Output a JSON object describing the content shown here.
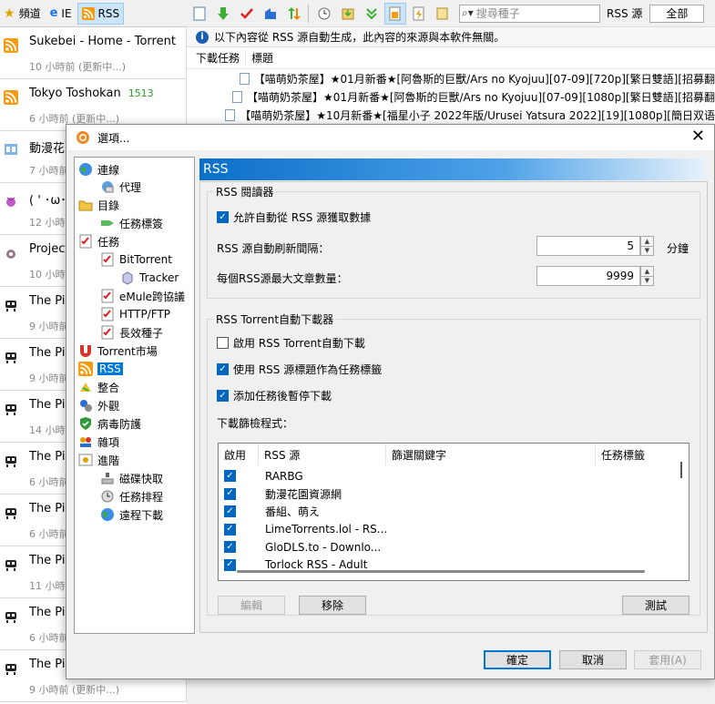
{
  "app_tabs": [
    {
      "label": "頻道",
      "icon": "star-icon"
    },
    {
      "label": "IE",
      "icon": "ie-icon"
    },
    {
      "label": "RSS",
      "icon": "rss-icon",
      "active": true
    }
  ],
  "feeds": [
    {
      "name": "Sukebei - Home - Torrent",
      "count": "",
      "time": "10 小時前 (更新中...)",
      "icon": "rss-icon"
    },
    {
      "name": "Tokyo Toshokan",
      "count": "1513",
      "time": "6 小時前 (更新中...)",
      "icon": "rss-icon"
    },
    {
      "name": "動漫花",
      "count": "",
      "time": "7 小時前",
      "icon": "anime-icon"
    },
    {
      "name": "( ' ･ω･",
      "count": "",
      "time": "12 小時前",
      "icon": "purple-icon"
    },
    {
      "name": "Project",
      "count": "",
      "time": "10 小時前",
      "icon": "project-icon"
    },
    {
      "name": "The Pir",
      "count": "",
      "time": "9 小時前",
      "icon": "pirate-icon"
    },
    {
      "name": "The Pir",
      "count": "",
      "time": "9 小時前",
      "icon": "pirate-icon"
    },
    {
      "name": "The Pir",
      "count": "",
      "time": "14 小時前",
      "icon": "pirate-icon"
    },
    {
      "name": "The Pir",
      "count": "",
      "time": "6 小時前",
      "icon": "pirate-icon"
    },
    {
      "name": "The Pir",
      "count": "",
      "time": "6 小時前",
      "icon": "pirate-icon"
    },
    {
      "name": "The Pir",
      "count": "",
      "time": "11 小時前",
      "icon": "pirate-icon"
    },
    {
      "name": "The Pir",
      "count": "",
      "time": "6 小時前",
      "icon": "pirate-icon"
    },
    {
      "name": "The Pir",
      "count": "",
      "time": "9 小時前 (更新中...)",
      "icon": "pirate-icon"
    }
  ],
  "toolbar": {
    "search_placeholder": "搜尋種子",
    "rss_source_label": "RSS 源",
    "rss_source_value": "全部"
  },
  "info_bar": "以下內容從 RSS 源自動生成，此內容的來源與本軟件無關。",
  "list": {
    "col_task": "下載任務",
    "col_title": "標題",
    "rows": [
      "【喵萌奶茶屋】★01月新番★[阿魯斯的巨獸/Ars no Kyojuu][07-09][720p][繁日雙語][招募翻",
      "【喵萌奶茶屋】★01月新番★[阿魯斯的巨獸/Ars no Kyojuu][07-09][1080p][繁日雙語][招募翻",
      "【喵萌奶茶屋】★10月新番★[福星小子 2022年版/Urusei Yatsura 2022][19][1080p][簡日双语"
    ]
  },
  "dialog": {
    "title": "選項...",
    "tree": [
      {
        "label": "連線",
        "icon": "globe-icon"
      },
      {
        "label": "代理",
        "icon": "proxy-icon"
      },
      {
        "label": "目錄",
        "icon": "folder-icon"
      },
      {
        "label": "任務標簽",
        "icon": "tag-icon"
      },
      {
        "label": "任務",
        "icon": "task-icon"
      },
      {
        "label": "BitTorrent",
        "icon": "bittorrent-icon"
      },
      {
        "label": "Tracker",
        "icon": "tracker-icon"
      },
      {
        "label": "eMule跨協議",
        "icon": "emule-icon"
      },
      {
        "label": "HTTP/FTP",
        "icon": "http-icon"
      },
      {
        "label": "長效種子",
        "icon": "seed-icon"
      },
      {
        "label": "Torrent市場",
        "icon": "magnet-icon"
      },
      {
        "label": "RSS",
        "icon": "rss-icon"
      },
      {
        "label": "整合",
        "icon": "integrate-icon"
      },
      {
        "label": "外觀",
        "icon": "appearance-icon"
      },
      {
        "label": "病毒防護",
        "icon": "shield-icon"
      },
      {
        "label": "雜項",
        "icon": "misc-icon"
      },
      {
        "label": "進階",
        "icon": "advanced-icon"
      },
      {
        "label": "磁碟快取",
        "icon": "disk-icon"
      },
      {
        "label": "任務排程",
        "icon": "schedule-icon"
      },
      {
        "label": "遠程下載",
        "icon": "remote-icon"
      }
    ],
    "section_title": "RSS",
    "reader": {
      "title": "RSS 閱讀器",
      "auto_fetch_label": "允許自動從 RSS 源獲取數據",
      "refresh_label": "RSS 源自動刷新間隔：",
      "refresh_value": "5",
      "refresh_unit": "分鐘",
      "max_label": "每個RSS源最大文章數量：",
      "max_value": "9999"
    },
    "downloader": {
      "title": "RSS Torrent自動下載器",
      "enable_label": "啟用 RSS Torrent自動下載",
      "use_title_label": "使用 RSS 源標題作為任務標籤",
      "pause_label": "添加任務後暫停下載",
      "filter_label": "下載篩檢程式：",
      "columns": [
        "啟用",
        "RSS 源",
        "篩選關鍵字",
        "任務標籤"
      ],
      "rows": [
        "RARBG",
        "動漫花園資源網",
        "番組、萌え",
        "LimeTorrents.lol - RS...",
        "GloDLS.to - Downlo...",
        "Torlock RSS - Adult"
      ],
      "edit": "編輯",
      "remove": "移除",
      "test": "測試"
    },
    "ok": "確定",
    "cancel": "取消",
    "apply": "套用(A)"
  }
}
